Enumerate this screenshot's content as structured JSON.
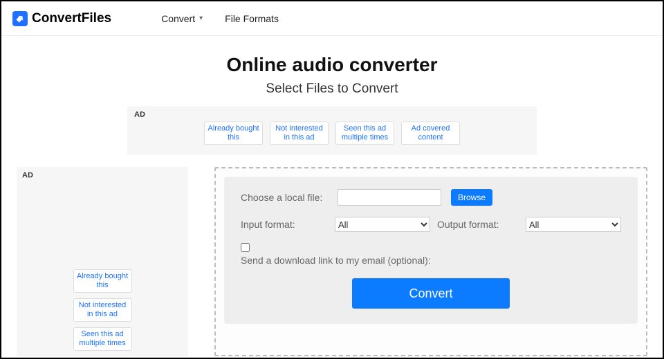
{
  "header": {
    "brand": "ConvertFiles",
    "nav": {
      "convert": "Convert",
      "formats": "File Formats"
    }
  },
  "page": {
    "title": "Online audio converter",
    "subtitle": "Select Files to Convert"
  },
  "ad_top": {
    "label": "AD",
    "options": [
      "Already bought this",
      "Not interested in this ad",
      "Seen this ad multiple times",
      "Ad covered content"
    ]
  },
  "ad_side": {
    "label": "AD",
    "options": [
      "Already bought this",
      "Not interested in this ad",
      "Seen this ad multiple times"
    ]
  },
  "form": {
    "choose_label": "Choose a local file:",
    "file_value": "",
    "browse": "Browse",
    "input_format_label": "Input format:",
    "input_format_value": "All",
    "output_format_label": "Output format:",
    "output_format_value": "All",
    "email_label": "Send a download link to my email (optional):",
    "convert": "Convert"
  }
}
